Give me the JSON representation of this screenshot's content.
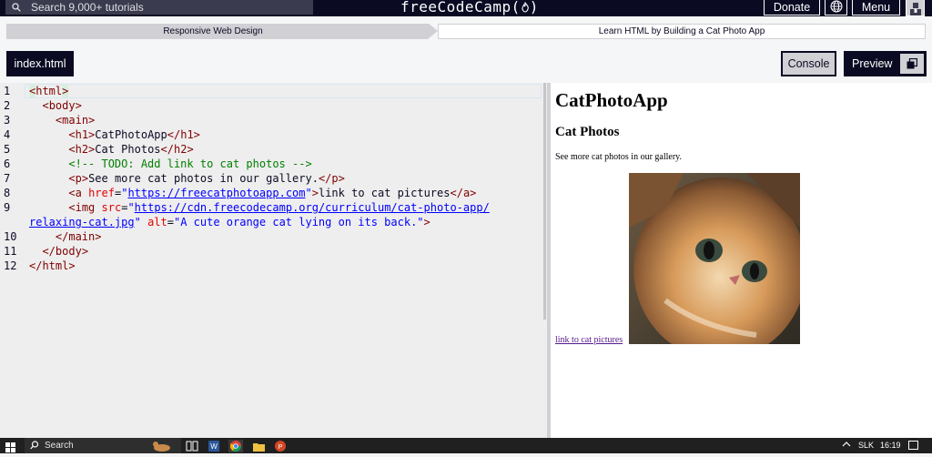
{
  "topnav": {
    "search_placeholder": "Search 9,000+ tutorials",
    "logo": "freeCodeCamp(🔥)",
    "logo_text": "freeCodeCamp(",
    "logo_close": ")",
    "donate": "Donate",
    "menu": "Menu"
  },
  "breadcrumb": {
    "superblock": "Responsive Web Design",
    "block": "Learn HTML by Building a Cat Photo App"
  },
  "toolbar": {
    "file_tab": "index.html",
    "console": "Console",
    "preview": "Preview"
  },
  "editor": {
    "line_numbers": [
      "1",
      "2",
      "3",
      "4",
      "5",
      "6",
      "7",
      "8",
      "9",
      "10",
      "11",
      "12"
    ]
  },
  "preview": {
    "h1": "CatPhotoApp",
    "h2": "Cat Photos",
    "p": "See more cat photos in our gallery.",
    "link": "link to cat pictures",
    "img_alt": "A cute orange cat lying on its back."
  },
  "taskbar": {
    "search": "Search",
    "lang": "SLK",
    "time": "16:19"
  },
  "colors": {
    "nav_bg": "#0a0a23",
    "editor_bg": "#eeeeee",
    "tag": "#800000",
    "attr": "#e50000",
    "string": "#0000ff",
    "comment": "#008000"
  }
}
